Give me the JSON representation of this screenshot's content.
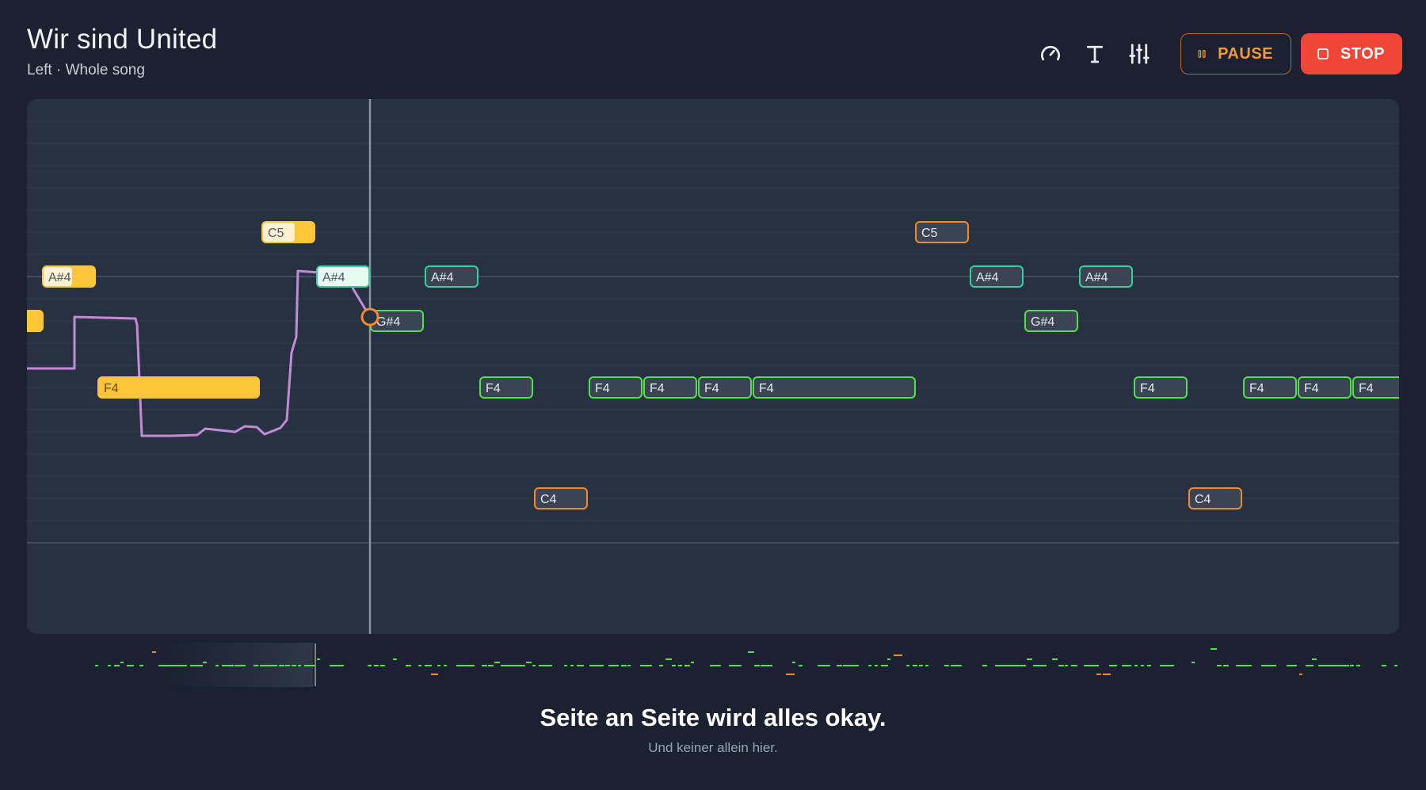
{
  "song": {
    "title": "Wir sind United",
    "subtitle": "Left · Whole song"
  },
  "toolbar": {
    "speed_icon": "gauge-icon",
    "text_icon": "text-icon",
    "mixer_icon": "sliders-icon",
    "pause_label": "PAUSE",
    "stop_label": "STOP"
  },
  "colors": {
    "played_fill": "#fcc53a",
    "current_fill": "#e8fbf2",
    "pitch_trace": "#c48ad6",
    "note_green": "#54e04c",
    "note_teal": "#33d2a0",
    "note_orange": "#f08a2c",
    "stop": "#ef4638",
    "pause": "#f29a3b"
  },
  "roll": {
    "played": [
      {
        "label": "",
        "pitch": "G#4"
      },
      {
        "label": "A#4",
        "pitch": "A#4"
      },
      {
        "label": "F4",
        "pitch": "F4"
      },
      {
        "label": "C5",
        "pitch": "C5"
      }
    ],
    "current": {
      "label": "A#4",
      "pitch": "A#4"
    },
    "upcoming": [
      {
        "label": "G#4",
        "pitch": "G#4"
      },
      {
        "label": "A#4",
        "pitch": "A#4"
      },
      {
        "label": "F4",
        "pitch": "F4"
      },
      {
        "label": "C4",
        "pitch": "C4"
      },
      {
        "label": "F4",
        "pitch": "F4"
      },
      {
        "label": "F4",
        "pitch": "F4"
      },
      {
        "label": "F4",
        "pitch": "F4"
      },
      {
        "label": "F4",
        "pitch": "F4"
      },
      {
        "label": "C5",
        "pitch": "C5"
      },
      {
        "label": "A#4",
        "pitch": "A#4"
      },
      {
        "label": "G#4",
        "pitch": "G#4"
      },
      {
        "label": "A#4",
        "pitch": "A#4"
      },
      {
        "label": "F4",
        "pitch": "F4"
      },
      {
        "label": "C4",
        "pitch": "C4"
      },
      {
        "label": "F4",
        "pitch": "F4"
      },
      {
        "label": "F4",
        "pitch": "F4"
      },
      {
        "label": "F4",
        "pitch": "F4"
      }
    ]
  },
  "lyrics": {
    "current": "Seite an Seite wird alles okay.",
    "next": "Und keiner allein hier."
  }
}
